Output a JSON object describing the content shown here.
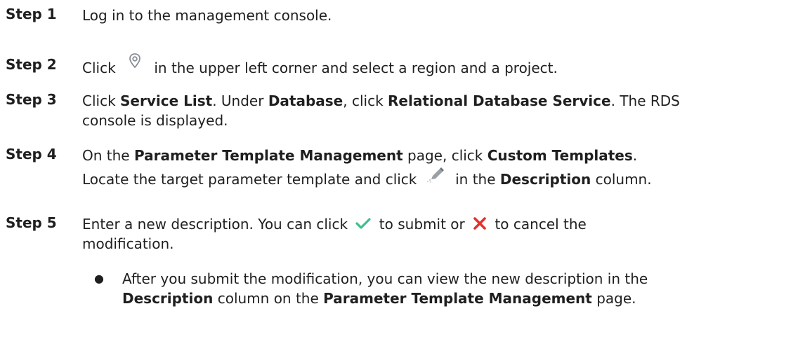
{
  "steps": [
    {
      "label": "Step 1",
      "text_a": "Log in to the management console."
    },
    {
      "label": "Step 2",
      "text_a": "Click",
      "text_b": "in the upper left corner and select a region and a project."
    },
    {
      "label": "Step 3",
      "text_a": "Click",
      "b1": "Service List",
      "text_b": ". Under",
      "b2": "Database",
      "text_c": ", click",
      "b3": "Relational Database Service",
      "text_d": ". The RDS",
      "text_e": "console is displayed."
    },
    {
      "label": "Step 4",
      "text_a": "On the",
      "b1": "Parameter Template Management",
      "text_b": "page, click",
      "b2": "Custom Templates",
      "text_c": ".",
      "text_d": "Locate the target parameter template and click",
      "text_e": "in the",
      "b3": "Description",
      "text_f": "column."
    },
    {
      "label": "Step 5",
      "text_a": "Enter a new description. You can click",
      "text_b": "to submit or",
      "text_c": "to cancel the",
      "text_d": "modification."
    }
  ],
  "bullet": {
    "dot": "●",
    "text_a": "After you submit the modification, you can view the new description in the",
    "b1": "Description",
    "text_b": "column on the",
    "b2": "Parameter Template Management",
    "text_c": "page."
  },
  "icons": {
    "location": "location-pin-icon",
    "edit": "pencil-edit-icon",
    "confirm": "checkmark-icon",
    "cancel": "cross-icon"
  },
  "colors": {
    "text": "#1f1f1f",
    "check": "#3cc08a",
    "cross": "#e5312a",
    "pin": "#8a8f96"
  }
}
